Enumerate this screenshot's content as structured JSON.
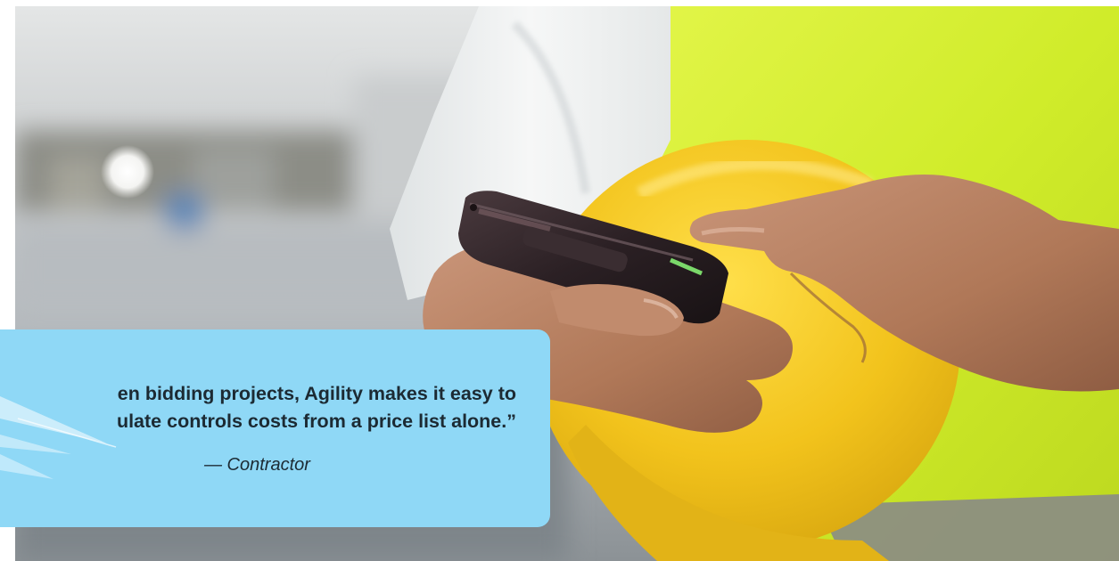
{
  "hero": {
    "image": "photo-worker-phone-hardhat"
  },
  "testimonial": {
    "lines": [
      "en bidding projects, Agility makes it easy to",
      "ulate controls costs from a price list alone.”"
    ],
    "attribution": "— Contractor",
    "card_color": "#8fd8f6",
    "text_color": "#1c2a33"
  },
  "colors": {
    "vest": "#d2ef2c",
    "hardhat": "#f3c81f",
    "shirt": "#eef0f0",
    "skin": "#b88263",
    "phone": "#2a1f22"
  }
}
